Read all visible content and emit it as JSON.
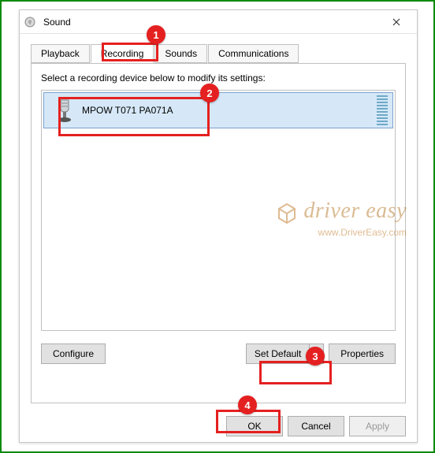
{
  "window": {
    "title": "Sound"
  },
  "tabs": {
    "playback": "Playback",
    "recording": "Recording",
    "sounds": "Sounds",
    "communications": "Communications"
  },
  "panel": {
    "instruction": "Select a recording device below to modify its settings:",
    "device": {
      "name": "MPOW T071 PA071A"
    }
  },
  "buttons": {
    "configure": "Configure",
    "set_default": "Set Default",
    "properties": "Properties",
    "ok": "OK",
    "cancel": "Cancel",
    "apply": "Apply"
  },
  "annotations": {
    "b1": "1",
    "b2": "2",
    "b3": "3",
    "b4": "4"
  },
  "watermark": {
    "brand": "driver easy",
    "url": "www.DriverEasy.com"
  }
}
